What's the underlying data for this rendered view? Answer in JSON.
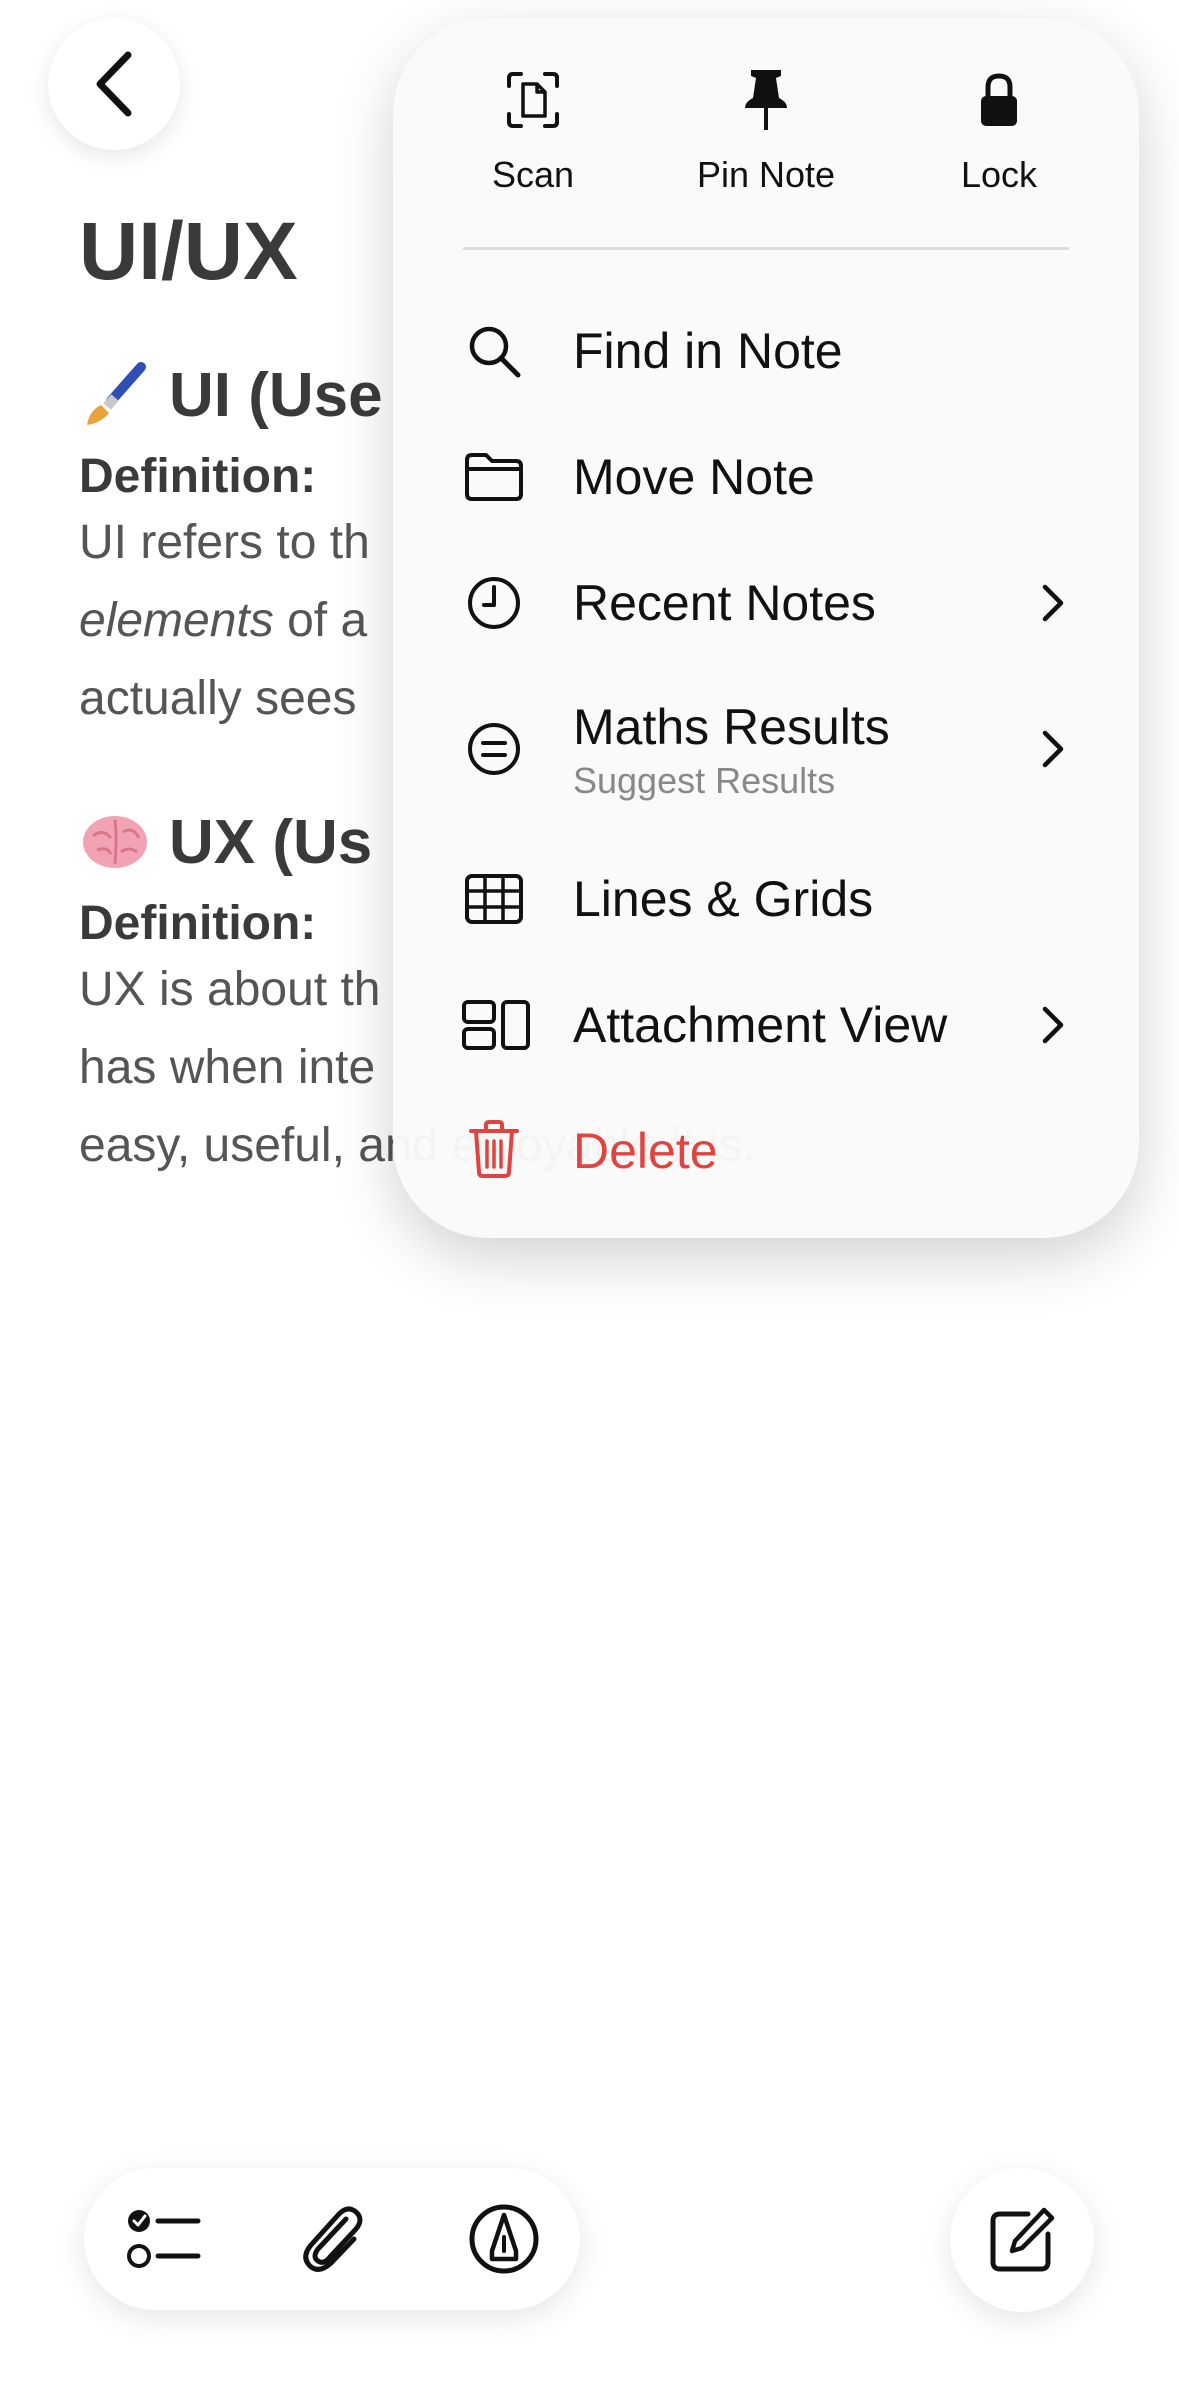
{
  "note": {
    "title": "UI/UX",
    "ui_section": {
      "heading": "UI (Use",
      "definition_label": "Definition:",
      "line1": "UI refers to th",
      "line2_italic": "elements",
      "line2_rest": " of a",
      "line3": "actually sees"
    },
    "ux_section": {
      "heading": "UX (Us",
      "definition_label": "Definition:",
      "line1": "UX is about th",
      "line2": "has when inte",
      "line3": "easy, useful, and enjoyable it is."
    }
  },
  "menu": {
    "quick_actions": [
      {
        "label": "Scan",
        "icon": "scan-document-icon"
      },
      {
        "label": "Pin Note",
        "icon": "pin-icon"
      },
      {
        "label": "Lock",
        "icon": "lock-icon"
      }
    ],
    "items": [
      {
        "label": "Find in Note",
        "icon": "search-icon"
      },
      {
        "label": "Move Note",
        "icon": "folder-icon"
      },
      {
        "label": "Recent Notes",
        "icon": "clock-icon",
        "has_submenu": true
      },
      {
        "label": "Maths Results",
        "sublabel": "Suggest Results",
        "icon": "equals-circle-icon",
        "has_submenu": true
      },
      {
        "label": "Lines & Grids",
        "icon": "grid-icon"
      },
      {
        "label": "Attachment View",
        "icon": "attachment-view-icon",
        "has_submenu": true
      },
      {
        "label": "Delete",
        "icon": "trash-icon",
        "destructive": true
      }
    ]
  },
  "toolbar": {
    "buttons": [
      "checklist-icon",
      "paperclip-icon",
      "markup-pen-icon"
    ],
    "compose": "compose-icon"
  },
  "colors": {
    "destructive": "#e0443e",
    "menu_bg": "#fafafa",
    "divider": "#dcdcdc"
  }
}
